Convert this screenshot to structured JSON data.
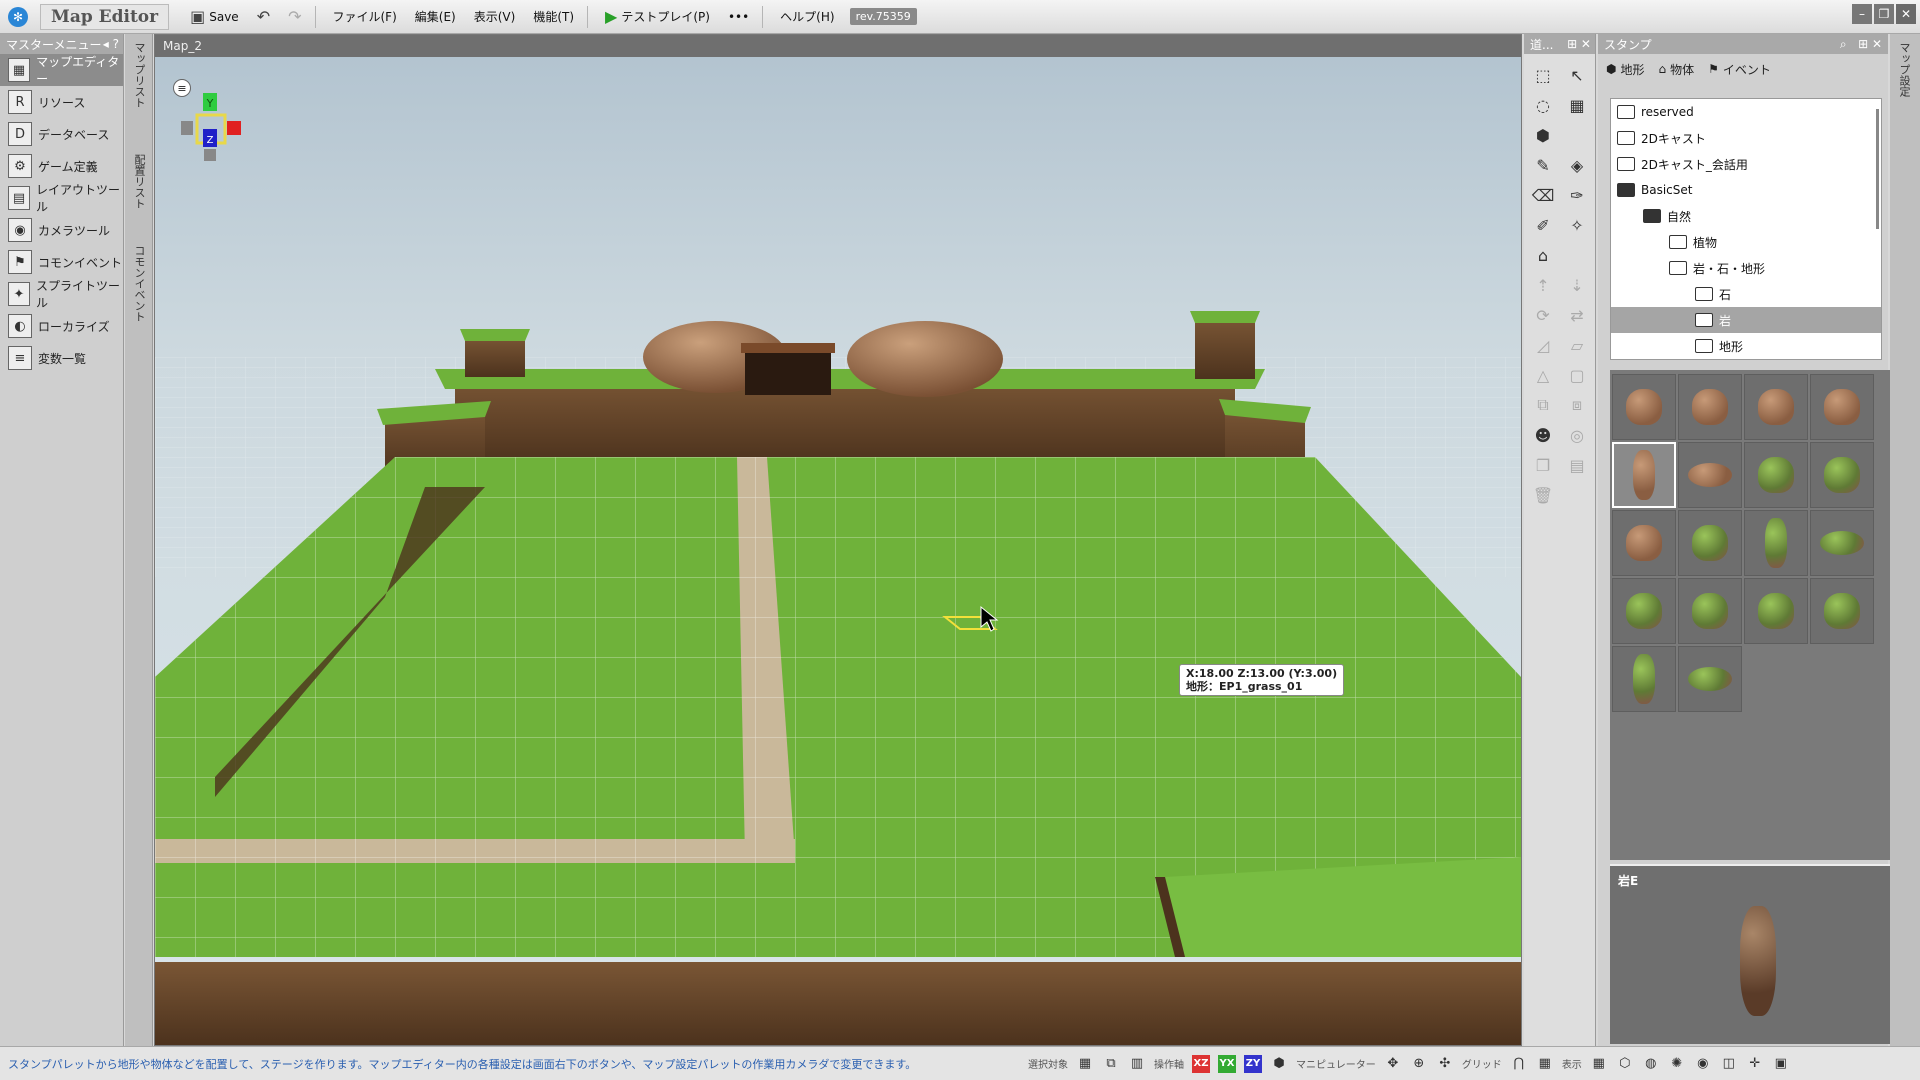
{
  "app": {
    "title": "Map Editor",
    "revision": "rev.75359"
  },
  "toolbar": {
    "save_label": "Save",
    "file_label": "ファイル(F)",
    "edit_label": "編集(E)",
    "view_label": "表示(V)",
    "function_label": "機能(T)",
    "testplay_label": "テストプレイ(P)",
    "help_label": "ヘルプ(H)"
  },
  "master_menu": {
    "title": "マスターメニュー",
    "items": [
      {
        "label": "マップエディター",
        "icon": "map-editor-icon"
      },
      {
        "label": "リソース",
        "icon": "resource-icon"
      },
      {
        "label": "データベース",
        "icon": "database-icon"
      },
      {
        "label": "ゲーム定義",
        "icon": "game-definition-icon"
      },
      {
        "label": "レイアウトツール",
        "icon": "layout-tool-icon"
      },
      {
        "label": "カメラツール",
        "icon": "camera-tool-icon"
      },
      {
        "label": "コモンイベント",
        "icon": "common-event-icon"
      },
      {
        "label": "スプライトツール",
        "icon": "sprite-tool-icon"
      },
      {
        "label": "ローカライズ",
        "icon": "localize-icon"
      },
      {
        "label": "変数一覧",
        "icon": "variable-list-icon"
      }
    ]
  },
  "vertical_tabs": [
    "マップリスト",
    "配置リスト",
    "コモンイベント"
  ],
  "viewport": {
    "title": "Map_2",
    "tooltip_line1": "X:18.00 Z:13.00 (Y:3.00)",
    "tooltip_line2": "地形：EP1_grass_01",
    "gizmo_y": "Y",
    "gizmo_z": "Z"
  },
  "tool_panel": {
    "title": "道..."
  },
  "stamp_panel": {
    "title": "スタンプ",
    "tabs": [
      {
        "label": "地形"
      },
      {
        "label": "物体"
      },
      {
        "label": "イベント"
      }
    ],
    "tree": [
      {
        "label": "reserved",
        "depth": 0,
        "open": false
      },
      {
        "label": "2Dキャスト",
        "depth": 0,
        "open": false
      },
      {
        "label": "2Dキャスト_会話用",
        "depth": 0,
        "open": false
      },
      {
        "label": "BasicSet",
        "depth": 0,
        "open": true
      },
      {
        "label": "自然",
        "depth": 1,
        "open": true
      },
      {
        "label": "植物",
        "depth": 2,
        "open": false
      },
      {
        "label": "岩・石・地形",
        "depth": 2,
        "open": false
      },
      {
        "label": "石",
        "depth": 3,
        "open": false
      },
      {
        "label": "岩",
        "depth": 3,
        "open": false,
        "selected": true
      },
      {
        "label": "地形",
        "depth": 3,
        "open": false
      }
    ],
    "preview_label": "岩E"
  },
  "right_vertical_tab": "マップ設定",
  "status": {
    "message": "スタンプパレットから地形や物体などを配置して、ステージを作ります。マップエディター内の各種設定は画面右下のボタンや、マップ設定パレットの作業用カメラダで変更できます。",
    "select_target_label": "選択対象",
    "operation_axis_label": "操作軸",
    "manipulator_label": "マニピュレーター",
    "grid_label": "グリッド",
    "display_label": "表示",
    "axis_xz": "XZ",
    "axis_yx": "YX",
    "axis_zy": "ZY"
  },
  "colors": {
    "grass": "#6fb23a",
    "dirt": "#6b4a2f",
    "accent_play": "#28a028",
    "panel_header": "#a9a9a9"
  }
}
